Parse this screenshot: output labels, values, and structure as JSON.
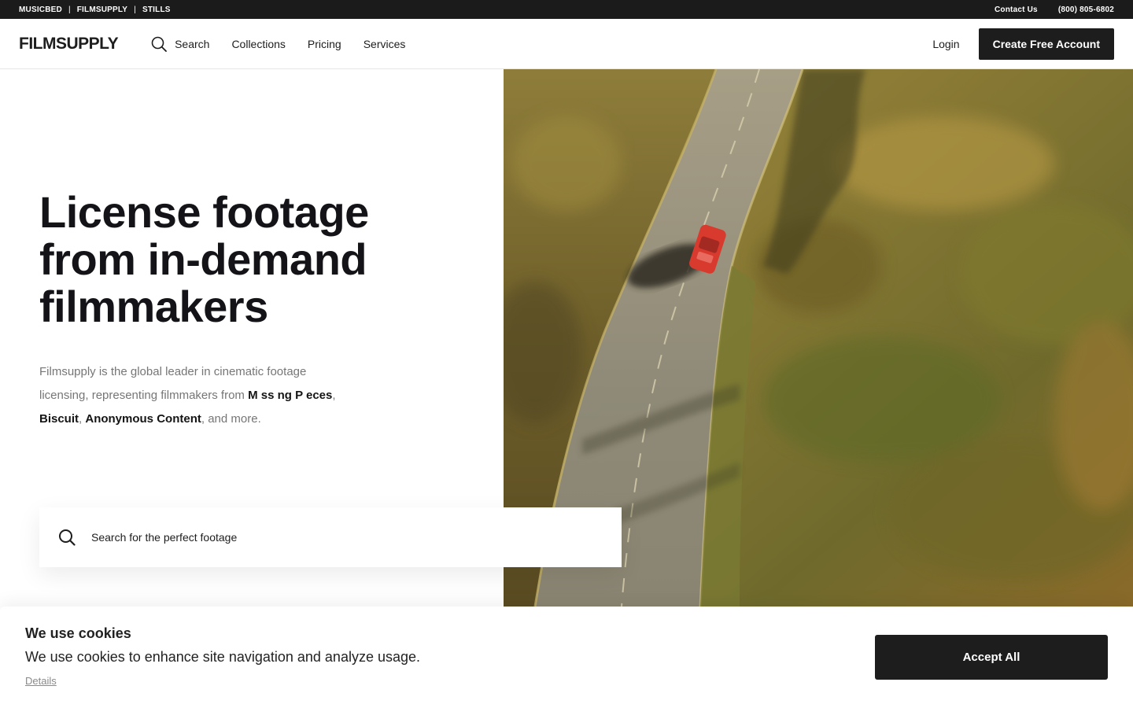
{
  "topbar": {
    "links": [
      "MUSICBED",
      "FILMSUPPLY",
      "STILLS"
    ],
    "separator": "|",
    "contact": "Contact Us",
    "phone": "(800) 805-6802"
  },
  "header": {
    "logo": "FILMSUPPLY",
    "nav": {
      "search": "Search",
      "collections": "Collections",
      "pricing": "Pricing",
      "services": "Services"
    },
    "login": "Login",
    "cta": "Create Free Account"
  },
  "hero": {
    "headline_line1": "License footage",
    "headline_line2": "from in-demand",
    "headline_line3": "filmmakers",
    "sub_intro": "Filmsupply is the global leader in cinematic footage licensing, representing filmmakers from ",
    "brand1": "M ss ng P eces",
    "comma1": ",",
    "brand2": "Biscuit",
    "comma2": ", ",
    "brand3": "Anonymous Content",
    "sub_outro": ", and more.",
    "image_icon": "aerial-road-red-car-photo",
    "search_placeholder": "Search for the perfect footage"
  },
  "cookie": {
    "title": "We use cookies",
    "text": "We use cookies to enhance site navigation and analyze usage.",
    "details": "Details",
    "accept": "Accept All"
  },
  "colors": {
    "dark": "#1d1d1d",
    "muted_text": "#767676"
  }
}
